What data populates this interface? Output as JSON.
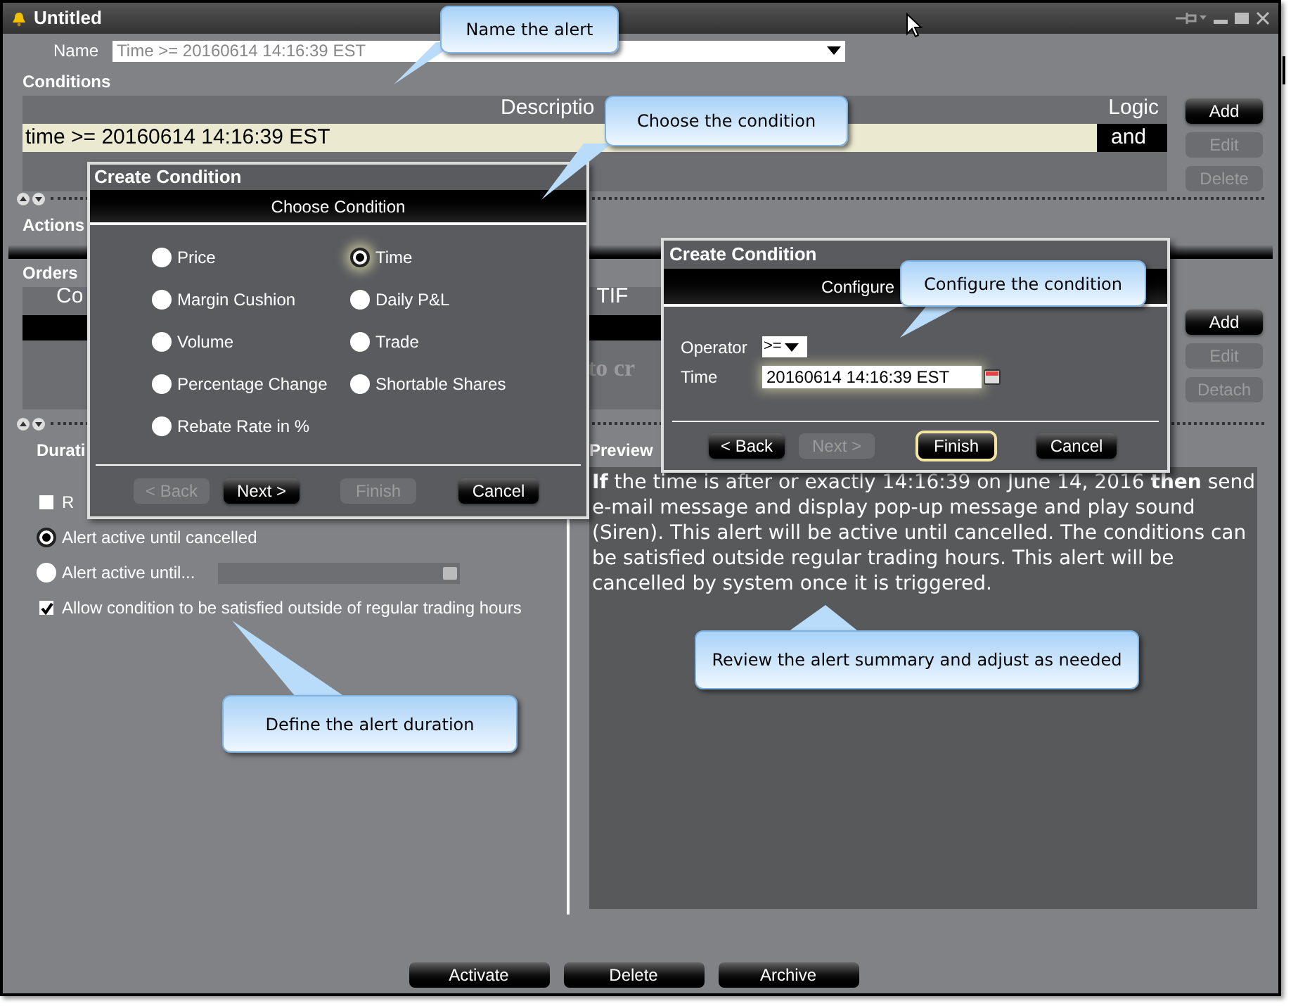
{
  "window": {
    "title": "Untitled"
  },
  "name_field": {
    "label": "Name",
    "value": "Time >= 20160614 14:16:39 EST"
  },
  "conditions": {
    "label": "Conditions",
    "columns": [
      "Descriptio",
      "Logic"
    ],
    "rows": [
      {
        "description": "time >= 20160614 14:16:39 EST",
        "logic": "and"
      }
    ],
    "buttons": [
      {
        "label": "Add",
        "disabled": false
      },
      {
        "label": "Edit",
        "disabled": true
      },
      {
        "label": "Delete",
        "disabled": true
      }
    ]
  },
  "actions": {
    "label": "Actions"
  },
  "orders": {
    "label": "Orders",
    "columns": [
      "Co",
      "TIF"
    ],
    "hint": "to cr",
    "buttons": [
      {
        "label": "Add",
        "disabled": false
      },
      {
        "label": "Edit",
        "disabled": true
      },
      {
        "label": "Detach",
        "disabled": true
      }
    ]
  },
  "duration": {
    "label": "Durati",
    "options": [
      {
        "kind": "checkbox",
        "label": "R",
        "checked": false
      },
      {
        "kind": "radio",
        "label": "Alert active until cancelled",
        "selected": true
      },
      {
        "kind": "radio-field",
        "label": "Alert active until...",
        "selected": false
      },
      {
        "kind": "checkbox",
        "label": "Allow condition to be satisfied outside of regular trading hours",
        "checked": true
      }
    ]
  },
  "preview": {
    "label": "Preview",
    "text": "**If** the time is after or exactly 14:16:39 on June 14, 2016 **then** send e-mail message and display pop-up message and play sound (Siren). This alert will be active until cancelled. The conditions can be satisfied outside regular trading hours. This alert will be cancelled by system once it is triggered."
  },
  "footer_buttons": [
    "Activate",
    "Delete",
    "Archive"
  ],
  "choose_dialog": {
    "title": "Create Condition",
    "header": "Choose Condition",
    "options": [
      {
        "label": "Price",
        "selected": false
      },
      {
        "label": "Time",
        "selected": true
      },
      {
        "label": "Margin Cushion",
        "selected": false
      },
      {
        "label": "Daily P&L",
        "selected": false
      },
      {
        "label": "Volume",
        "selected": false
      },
      {
        "label": "Trade",
        "selected": false
      },
      {
        "label": "Percentage Change",
        "selected": false
      },
      {
        "label": "Shortable Shares",
        "selected": false
      },
      {
        "label": "Rebate Rate in %",
        "selected": false
      }
    ],
    "buttons": [
      {
        "label": "< Back",
        "disabled": true
      },
      {
        "label": "Next >",
        "disabled": false
      },
      {
        "label": "Finish",
        "disabled": true
      },
      {
        "label": "Cancel",
        "disabled": false
      }
    ]
  },
  "configure_dialog": {
    "title": "Create Condition",
    "header": "Configure",
    "operator": {
      "label": "Operator",
      "value": ">="
    },
    "time": {
      "label": "Time",
      "value": "20160614 14:16:39 EST"
    },
    "buttons": [
      {
        "label": "< Back",
        "disabled": false,
        "focused": false
      },
      {
        "label": "Next >",
        "disabled": true,
        "focused": false
      },
      {
        "label": "Finish",
        "disabled": false,
        "focused": true
      },
      {
        "label": "Cancel",
        "disabled": false,
        "focused": false
      }
    ]
  },
  "callouts": [
    {
      "text": "Name the alert"
    },
    {
      "text": "Choose the condition"
    },
    {
      "text": "Configure the condition"
    },
    {
      "text": "Review the alert summary and adjust as needed"
    },
    {
      "text": "Define the alert duration"
    }
  ]
}
